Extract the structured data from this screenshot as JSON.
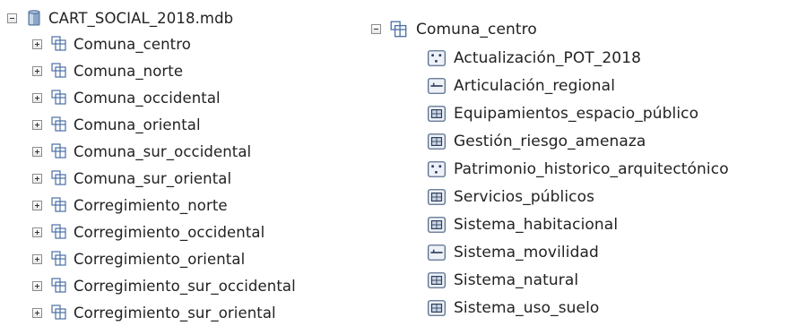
{
  "left_tree": {
    "root_label": "CART_SOCIAL_2018.mdb",
    "root_expanded": true,
    "items": [
      {
        "label": "Comuna_centro"
      },
      {
        "label": "Comuna_norte"
      },
      {
        "label": "Comuna_occidental"
      },
      {
        "label": "Comuna_oriental"
      },
      {
        "label": "Comuna_sur_occidental"
      },
      {
        "label": "Comuna_sur_oriental"
      },
      {
        "label": "Corregimiento_norte"
      },
      {
        "label": "Corregimiento_occidental"
      },
      {
        "label": "Corregimiento_oriental"
      },
      {
        "label": "Corregimiento_sur_occidental"
      },
      {
        "label": "Corregimiento_sur_oriental"
      }
    ]
  },
  "right_tree": {
    "root_label": "Comuna_centro",
    "root_expanded": true,
    "items": [
      {
        "label": "Actualización_POT_2018",
        "icon": "point-feature-class-icon"
      },
      {
        "label": "Articulación_regional",
        "icon": "line-feature-class-icon"
      },
      {
        "label": "Equipamientos_espacio_público",
        "icon": "polygon-feature-class-icon"
      },
      {
        "label": "Gestión_riesgo_amenaza",
        "icon": "polygon-feature-class-icon"
      },
      {
        "label": "Patrimonio_historico_arquitectónico",
        "icon": "point-feature-class-icon"
      },
      {
        "label": "Servicios_públicos",
        "icon": "polygon-feature-class-icon"
      },
      {
        "label": "Sistema_habitacional",
        "icon": "polygon-feature-class-icon"
      },
      {
        "label": "Sistema_movilidad",
        "icon": "line-feature-class-icon"
      },
      {
        "label": "Sistema_natural",
        "icon": "polygon-feature-class-icon"
      },
      {
        "label": "Sistema_uso_suelo",
        "icon": "polygon-feature-class-icon"
      }
    ]
  },
  "colors": {
    "database_icon": "#6e8fb8",
    "dataset_icon": "#4a6fa5",
    "feature_fill": "#e4eaf3",
    "feature_stroke": "#5a6f8f"
  }
}
